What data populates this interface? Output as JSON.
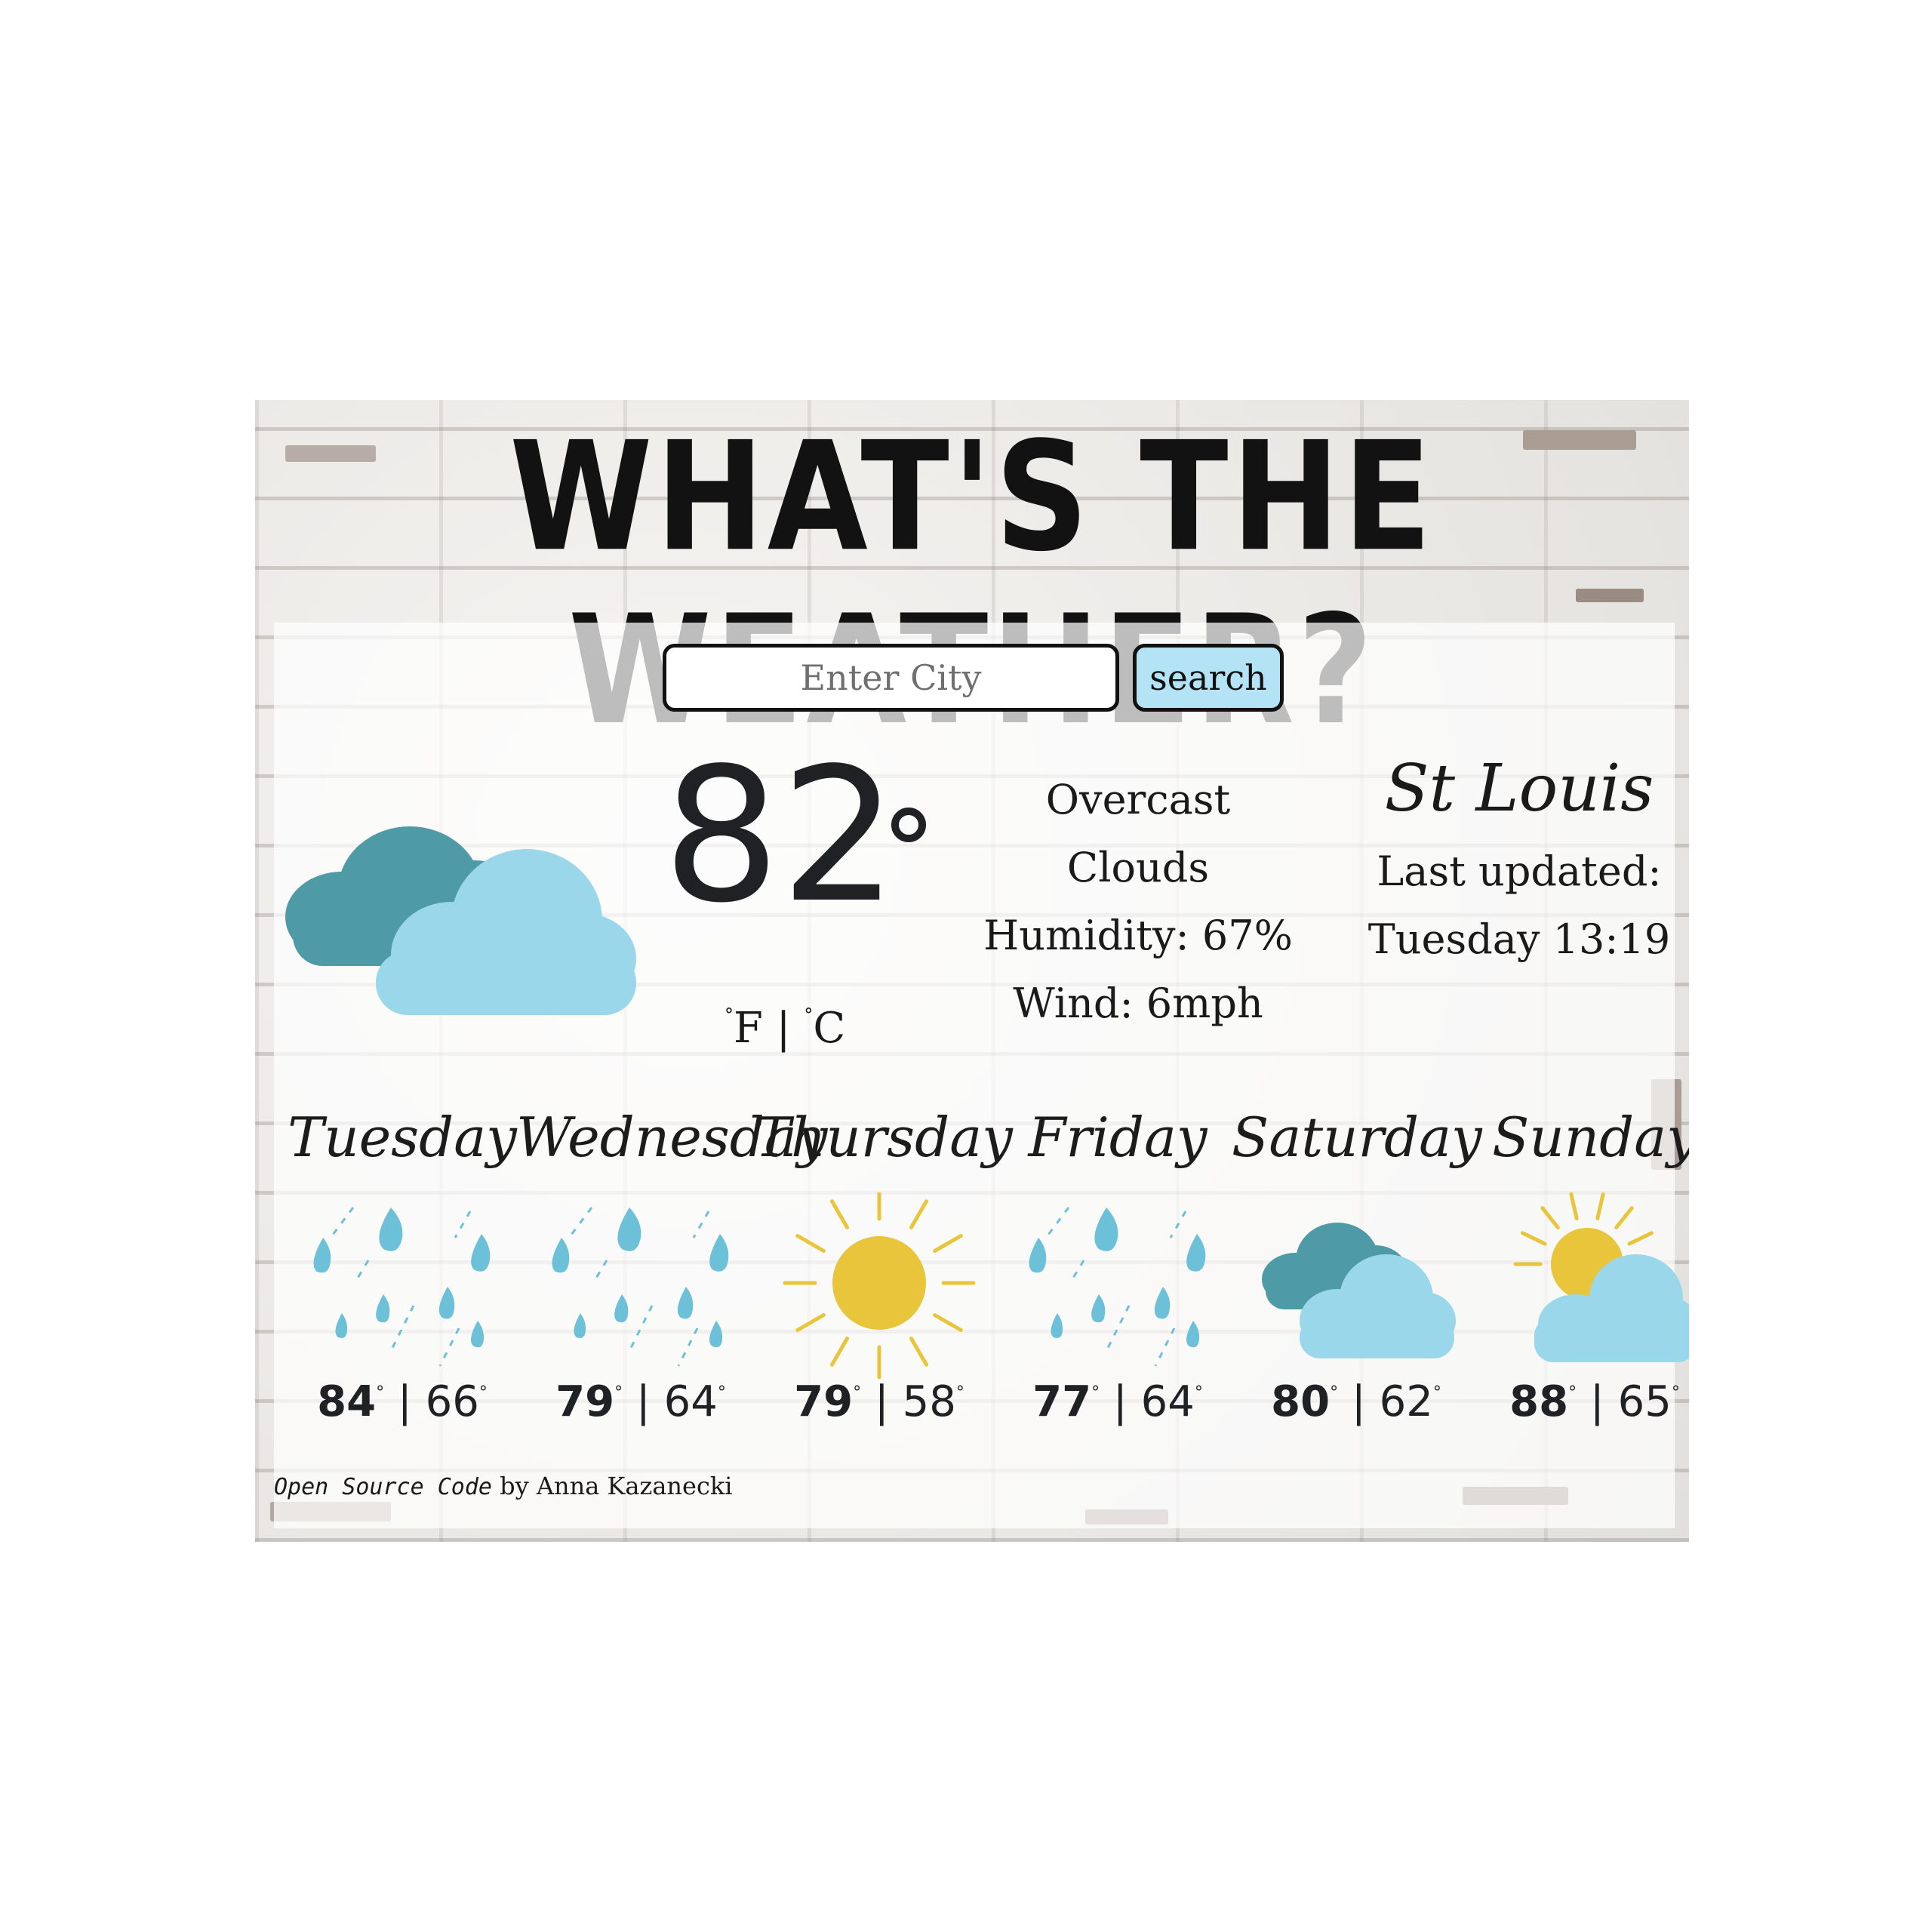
{
  "header": {
    "title": "WHAT'S THE WEATHER?"
  },
  "search": {
    "placeholder": "Enter City",
    "button_label": "search"
  },
  "current": {
    "temperature": "82",
    "icon": "overcast-clouds-icon",
    "unit_f": "F",
    "unit_separator": "|",
    "unit_c": "C",
    "description_line1": "Overcast",
    "description_line2": "Clouds",
    "humidity": "Humidity: 67%",
    "wind": "Wind: 6mph"
  },
  "location": {
    "city": "St Louis",
    "updated_label": "Last updated:",
    "updated_value": "Tuesday 13:19"
  },
  "forecast": [
    {
      "day": "Tuesday",
      "high": "84",
      "low": "66",
      "icon": "rain-icon"
    },
    {
      "day": "Wednesday",
      "high": "79",
      "low": "64",
      "icon": "rain-icon"
    },
    {
      "day": "Thursday",
      "high": "79",
      "low": "58",
      "icon": "sun-icon"
    },
    {
      "day": "Friday",
      "high": "77",
      "low": "64",
      "icon": "rain-icon"
    },
    {
      "day": "Saturday",
      "high": "80",
      "low": "62",
      "icon": "cloudy-icon"
    },
    {
      "day": "Sunday",
      "high": "88",
      "low": "65",
      "icon": "partly-sunny-icon"
    }
  ],
  "footer": {
    "code_label": "Open Source Code",
    "author": "by Anna Kazanecki"
  },
  "colors": {
    "accent_button": "#b3e3f4",
    "cloud_dark": "#4e9aa6",
    "cloud_light": "#9bd7ea",
    "sun": "#e8c53a",
    "rain": "#6cc0d8"
  }
}
